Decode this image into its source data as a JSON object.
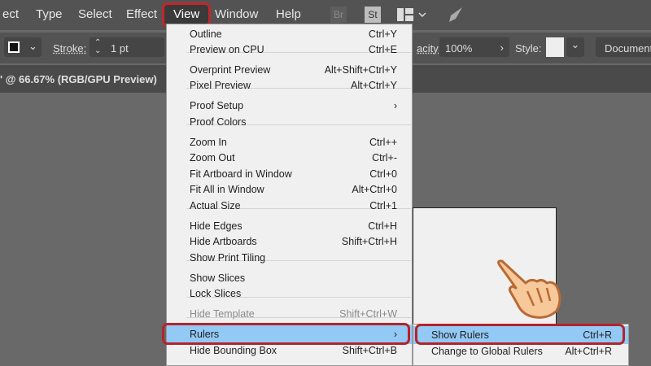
{
  "menubar": {
    "items": [
      "ect",
      "Type",
      "Select",
      "Effect",
      "View",
      "Window",
      "Help"
    ],
    "br": "Br",
    "st": "St"
  },
  "controlbar": {
    "stroke_label": "Stroke:",
    "stroke_value": "1 pt",
    "opacity_label": "acity:",
    "opacity_value": "100%",
    "style_label": "Style:",
    "document_button": "Document"
  },
  "doc_tab": {
    "title": "' @ 66.67% (RGB/GPU Preview)"
  },
  "view_menu": [
    {
      "label": "Outline",
      "shortcut": "Ctrl+Y"
    },
    {
      "label": "Preview on CPU",
      "shortcut": "Ctrl+E"
    },
    {
      "label": "Overprint Preview",
      "shortcut": "Alt+Shift+Ctrl+Y"
    },
    {
      "label": "Pixel Preview",
      "shortcut": "Alt+Ctrl+Y"
    },
    {
      "label": "Proof Setup",
      "shortcut": "›"
    },
    {
      "label": "Proof Colors",
      "shortcut": ""
    },
    {
      "label": "Zoom In",
      "shortcut": "Ctrl++"
    },
    {
      "label": "Zoom Out",
      "shortcut": "Ctrl+-"
    },
    {
      "label": "Fit Artboard in Window",
      "shortcut": "Ctrl+0"
    },
    {
      "label": "Fit All in Window",
      "shortcut": "Alt+Ctrl+0"
    },
    {
      "label": "Actual Size",
      "shortcut": "Ctrl+1"
    },
    {
      "label": "Hide Edges",
      "shortcut": "Ctrl+H"
    },
    {
      "label": "Hide Artboards",
      "shortcut": "Shift+Ctrl+H"
    },
    {
      "label": "Show Print Tiling",
      "shortcut": ""
    },
    {
      "label": "Show Slices",
      "shortcut": ""
    },
    {
      "label": "Lock Slices",
      "shortcut": ""
    },
    {
      "label": "Hide Template",
      "shortcut": "Shift+Ctrl+W"
    },
    {
      "label": "Rulers",
      "shortcut": "›"
    },
    {
      "label": "Hide Bounding Box",
      "shortcut": "Shift+Ctrl+B"
    }
  ],
  "rulers_submenu": [
    {
      "label": "Show Rulers",
      "shortcut": "Ctrl+R"
    },
    {
      "label": "Change to Global Rulers",
      "shortcut": "Alt+Ctrl+R"
    }
  ]
}
